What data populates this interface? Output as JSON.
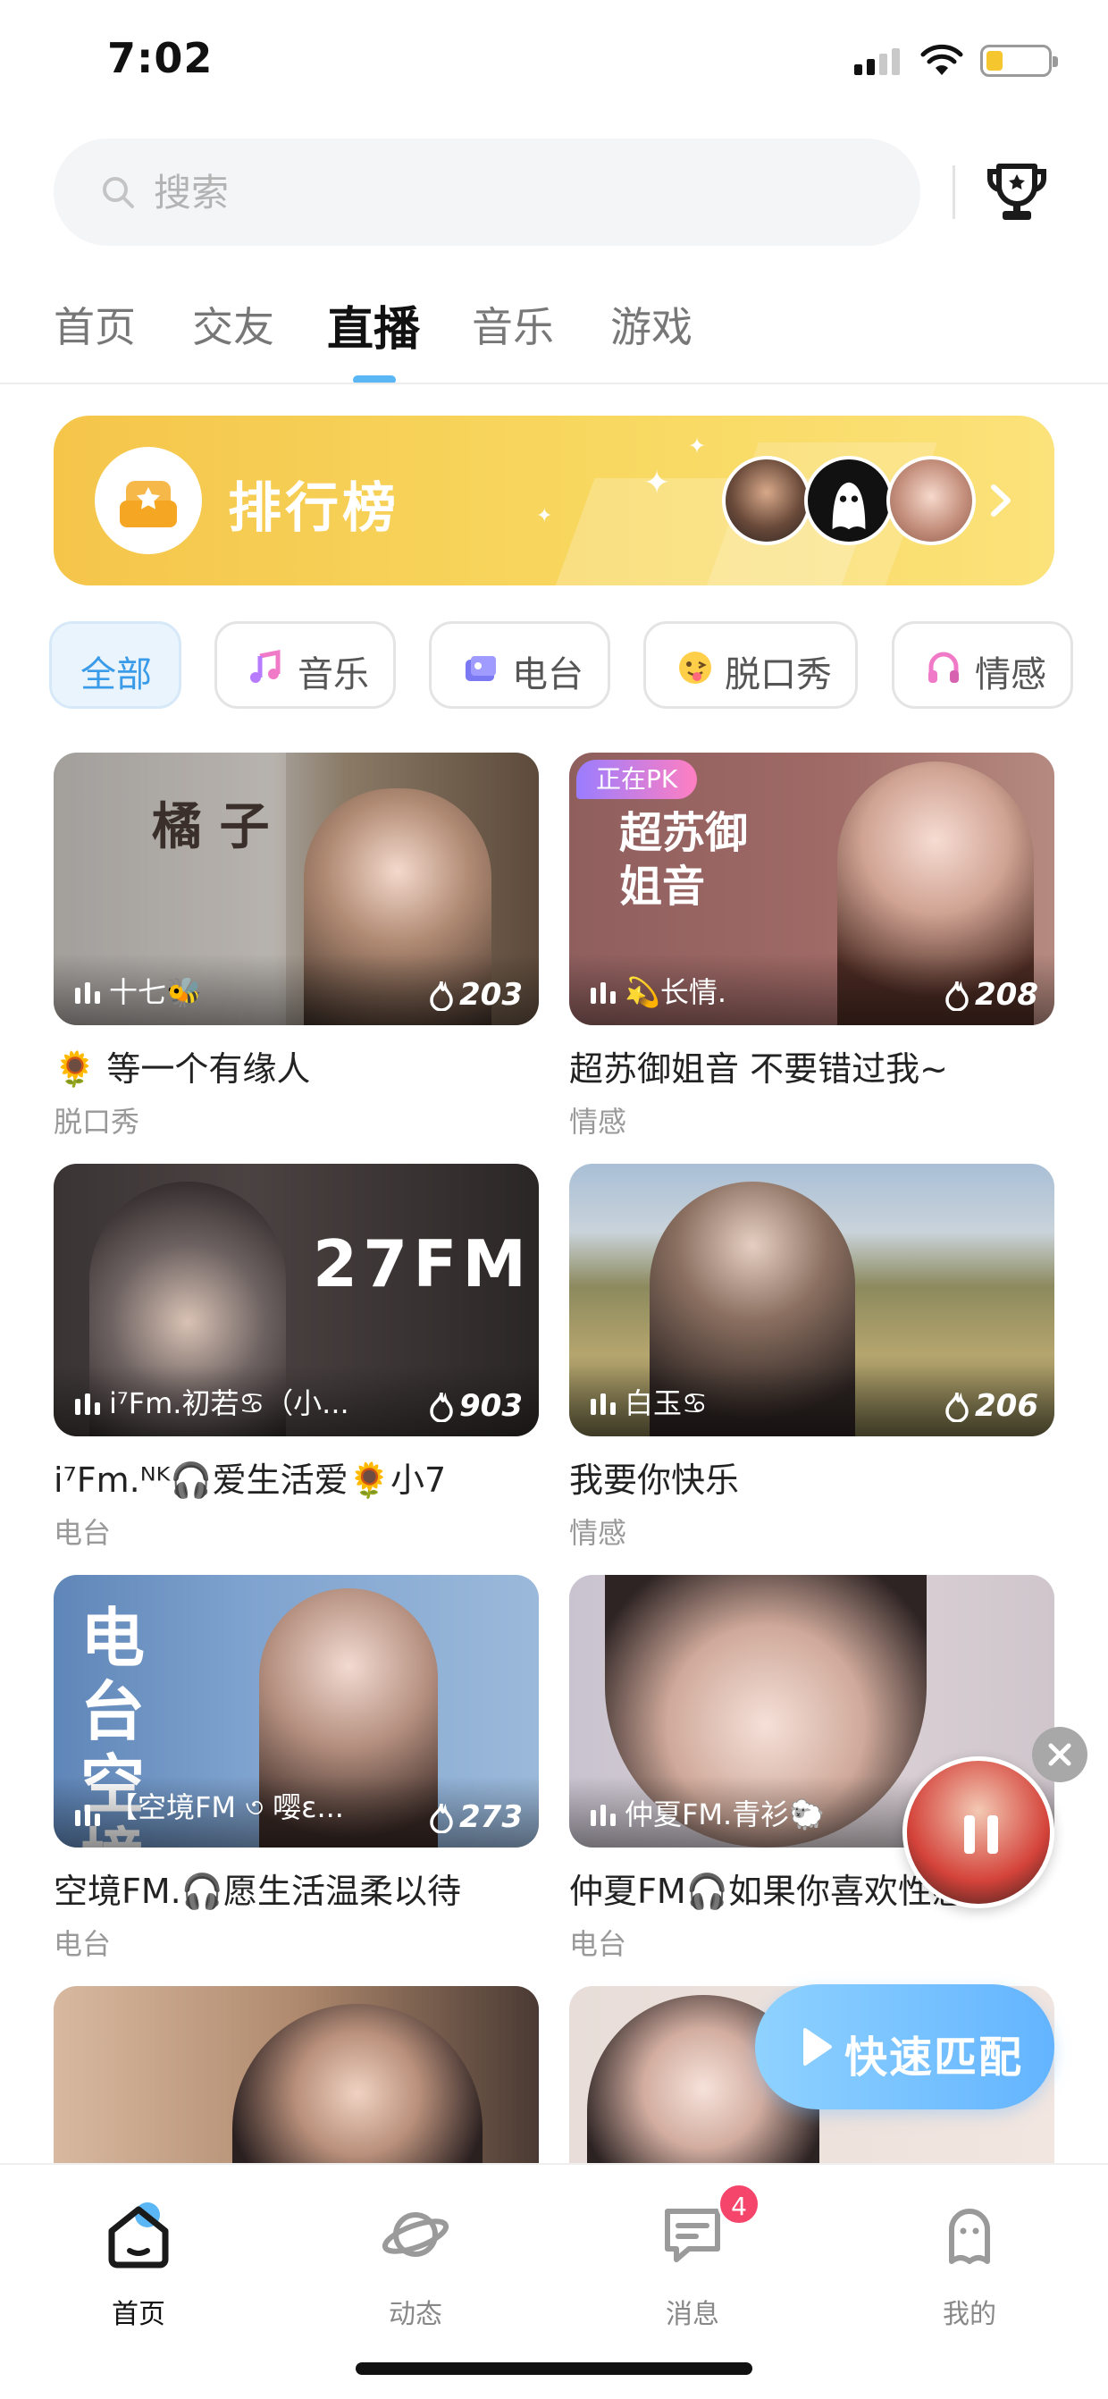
{
  "status_bar": {
    "time": "7:02"
  },
  "search": {
    "placeholder": "搜索"
  },
  "tabs": [
    {
      "label": "首页",
      "active": false
    },
    {
      "label": "交友",
      "active": false
    },
    {
      "label": "直播",
      "active": true
    },
    {
      "label": "音乐",
      "active": false
    },
    {
      "label": "游戏",
      "active": false
    }
  ],
  "ranking": {
    "title": "排行榜"
  },
  "categories": [
    {
      "label": "全部",
      "active": true
    },
    {
      "label": "音乐",
      "icon": "music-note-icon"
    },
    {
      "label": "电台",
      "icon": "radio-icon"
    },
    {
      "label": "脱口秀",
      "icon": "tongue-emoji-icon"
    },
    {
      "label": "情感",
      "icon": "headphones-icon"
    }
  ],
  "rooms": [
    {
      "host": "十七🐝",
      "heat": "203",
      "title": "🌻  等一个有缘人",
      "category": "脱口秀",
      "cover_text": "橘 子"
    },
    {
      "host": "💫长情.",
      "heat": "208",
      "title": "超苏御姐音 不要错过我~",
      "category": "情感",
      "badge": "正在PK",
      "cover_text": "超苏御姐音"
    },
    {
      "host": "i⁷Fm.初若♋（小...",
      "heat": "903",
      "title": "i⁷Fm.ᴺᴷ🎧爱生活爱🌻小7",
      "category": "电台",
      "cover_text": "27FM"
    },
    {
      "host": "白玉♋",
      "heat": "206",
      "title": "我要你快乐",
      "category": "情感"
    },
    {
      "host": "【空境FM ৩ 嘤ε...",
      "heat": "273",
      "title": "空境FM.🎧愿生活温柔以待",
      "category": "电台",
      "cover_text": "电台 空境"
    },
    {
      "host": "仲夏FM.青衫🐑",
      "heat": "",
      "title": "仲夏FM🎧如果你喜欢性感",
      "category": "电台"
    },
    {
      "host": "",
      "heat": "",
      "title": "",
      "category": ""
    },
    {
      "host": "",
      "heat": "",
      "title": "",
      "category": ""
    }
  ],
  "quick_match": {
    "label": "快速匹配"
  },
  "bottom_nav": [
    {
      "label": "首页",
      "icon": "home-icon",
      "active": true
    },
    {
      "label": "动态",
      "icon": "planet-icon"
    },
    {
      "label": "消息",
      "icon": "message-icon",
      "badge": "4"
    },
    {
      "label": "我的",
      "icon": "profile-icon"
    }
  ],
  "colors": {
    "accent": "#5ab6f5",
    "banner": "#f7cf4f",
    "badge": "#f5456b"
  }
}
